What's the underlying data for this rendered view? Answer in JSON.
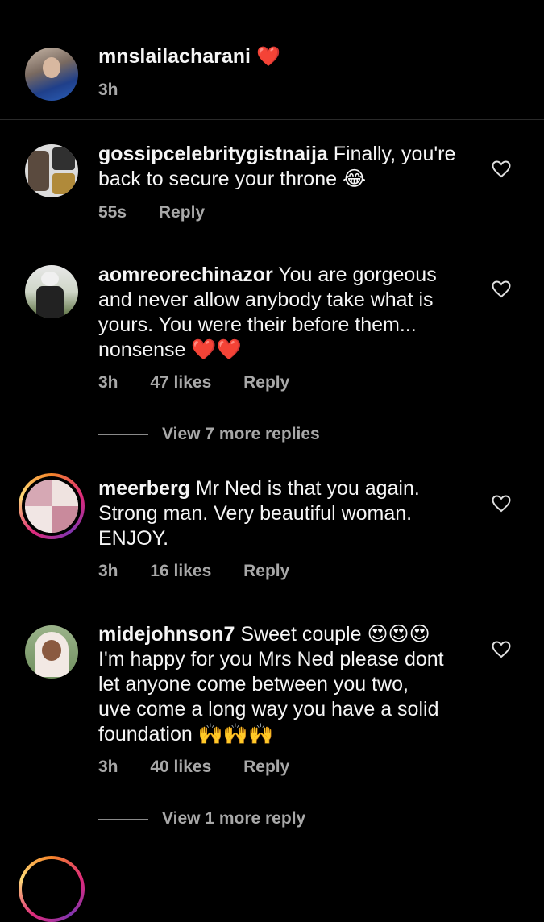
{
  "caption": {
    "username": "mnslailacharani",
    "emoji": "❤️",
    "time": "3h"
  },
  "comments": [
    {
      "username": "gossipcelebritygistnaija",
      "text_line1": " Finally, you're",
      "text_line2": "back to secure your throne 😂",
      "time": "55s",
      "likes": "",
      "reply": "Reply"
    },
    {
      "username": "aomreorechinazor",
      "text_line1": " You are gorgeous",
      "text_line2": "and never allow anybody take what is",
      "text_line3": "yours. You were their before them...",
      "text_line4": "nonsense ❤️❤️",
      "time": "3h",
      "likes": "47 likes",
      "reply": "Reply",
      "view_replies": "View 7 more replies"
    },
    {
      "username": "meerberg",
      "text_line1": " Mr Ned is that you again.",
      "text_line2": "Strong man. Very beautiful woman.",
      "text_line3": "ENJOY.",
      "time": "3h",
      "likes": "16 likes",
      "reply": "Reply"
    },
    {
      "username": "midejohnson7",
      "text_line1": " Sweet couple 😍😍😍",
      "text_line2": "I'm happy for you Mrs Ned please dont",
      "text_line3": "let anyone come between you two,",
      "text_line4": "uve come a long way you have a solid",
      "text_line5": "foundation 🙌🙌🙌",
      "time": "3h",
      "likes": "40 likes",
      "reply": "Reply",
      "view_replies": "View 1 more reply"
    }
  ],
  "icons": {
    "like": "heart-outline-icon"
  },
  "colors": {
    "background": "#000000",
    "text": "#f5f5f5",
    "secondary": "#a8a8a8"
  }
}
